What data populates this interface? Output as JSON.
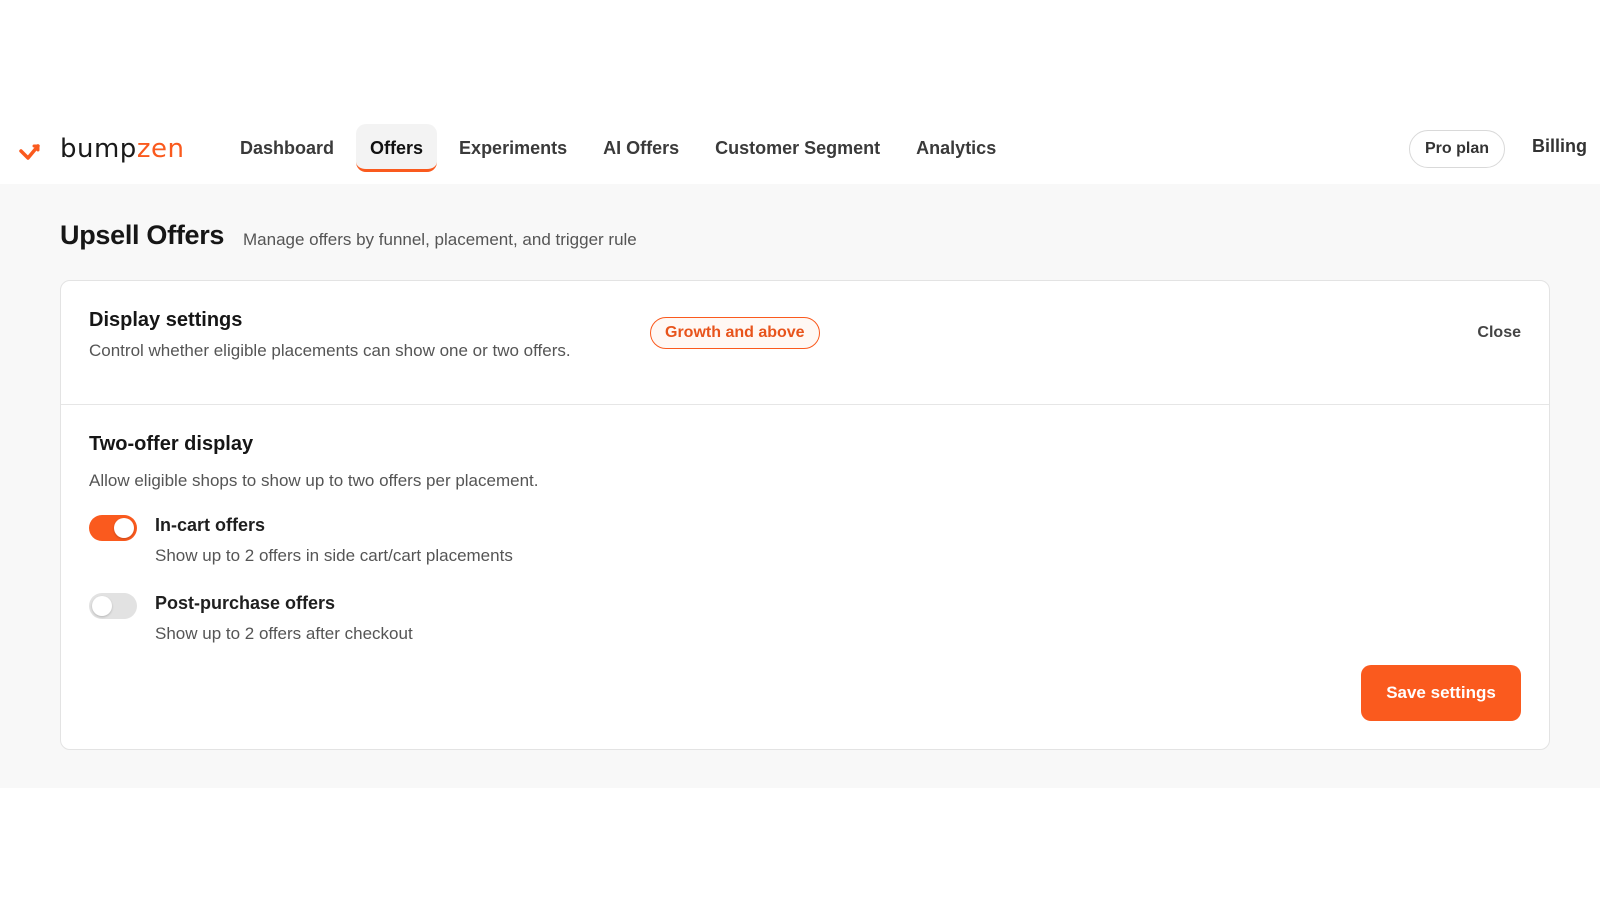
{
  "brand": {
    "name_prefix": "bump",
    "name_suffix": "zen",
    "accent_color": "#fa5a1e"
  },
  "nav": {
    "tabs": [
      {
        "label": "Dashboard",
        "active": false
      },
      {
        "label": "Offers",
        "active": true
      },
      {
        "label": "Experiments",
        "active": false
      },
      {
        "label": "AI Offers",
        "active": false
      },
      {
        "label": "Customer Segment",
        "active": false
      },
      {
        "label": "Analytics",
        "active": false
      }
    ],
    "plan_label": "Pro plan",
    "billing_label": "Billing"
  },
  "page": {
    "title": "Upsell Offers",
    "subtitle": "Manage offers by funnel, placement, and trigger rule"
  },
  "display_settings": {
    "title": "Display settings",
    "description": "Control whether eligible placements can show one or two offers.",
    "badge": "Growth and above",
    "close_label": "Close"
  },
  "two_offer": {
    "title": "Two-offer display",
    "description": "Allow eligible shops to show up to two offers per placement.",
    "toggles": [
      {
        "label": "In-cart offers",
        "sublabel": "Show up to 2 offers in side cart/cart placements",
        "on": true
      },
      {
        "label": "Post-purchase offers",
        "sublabel": "Show up to 2 offers after checkout",
        "on": false
      }
    ],
    "save_label": "Save settings"
  }
}
